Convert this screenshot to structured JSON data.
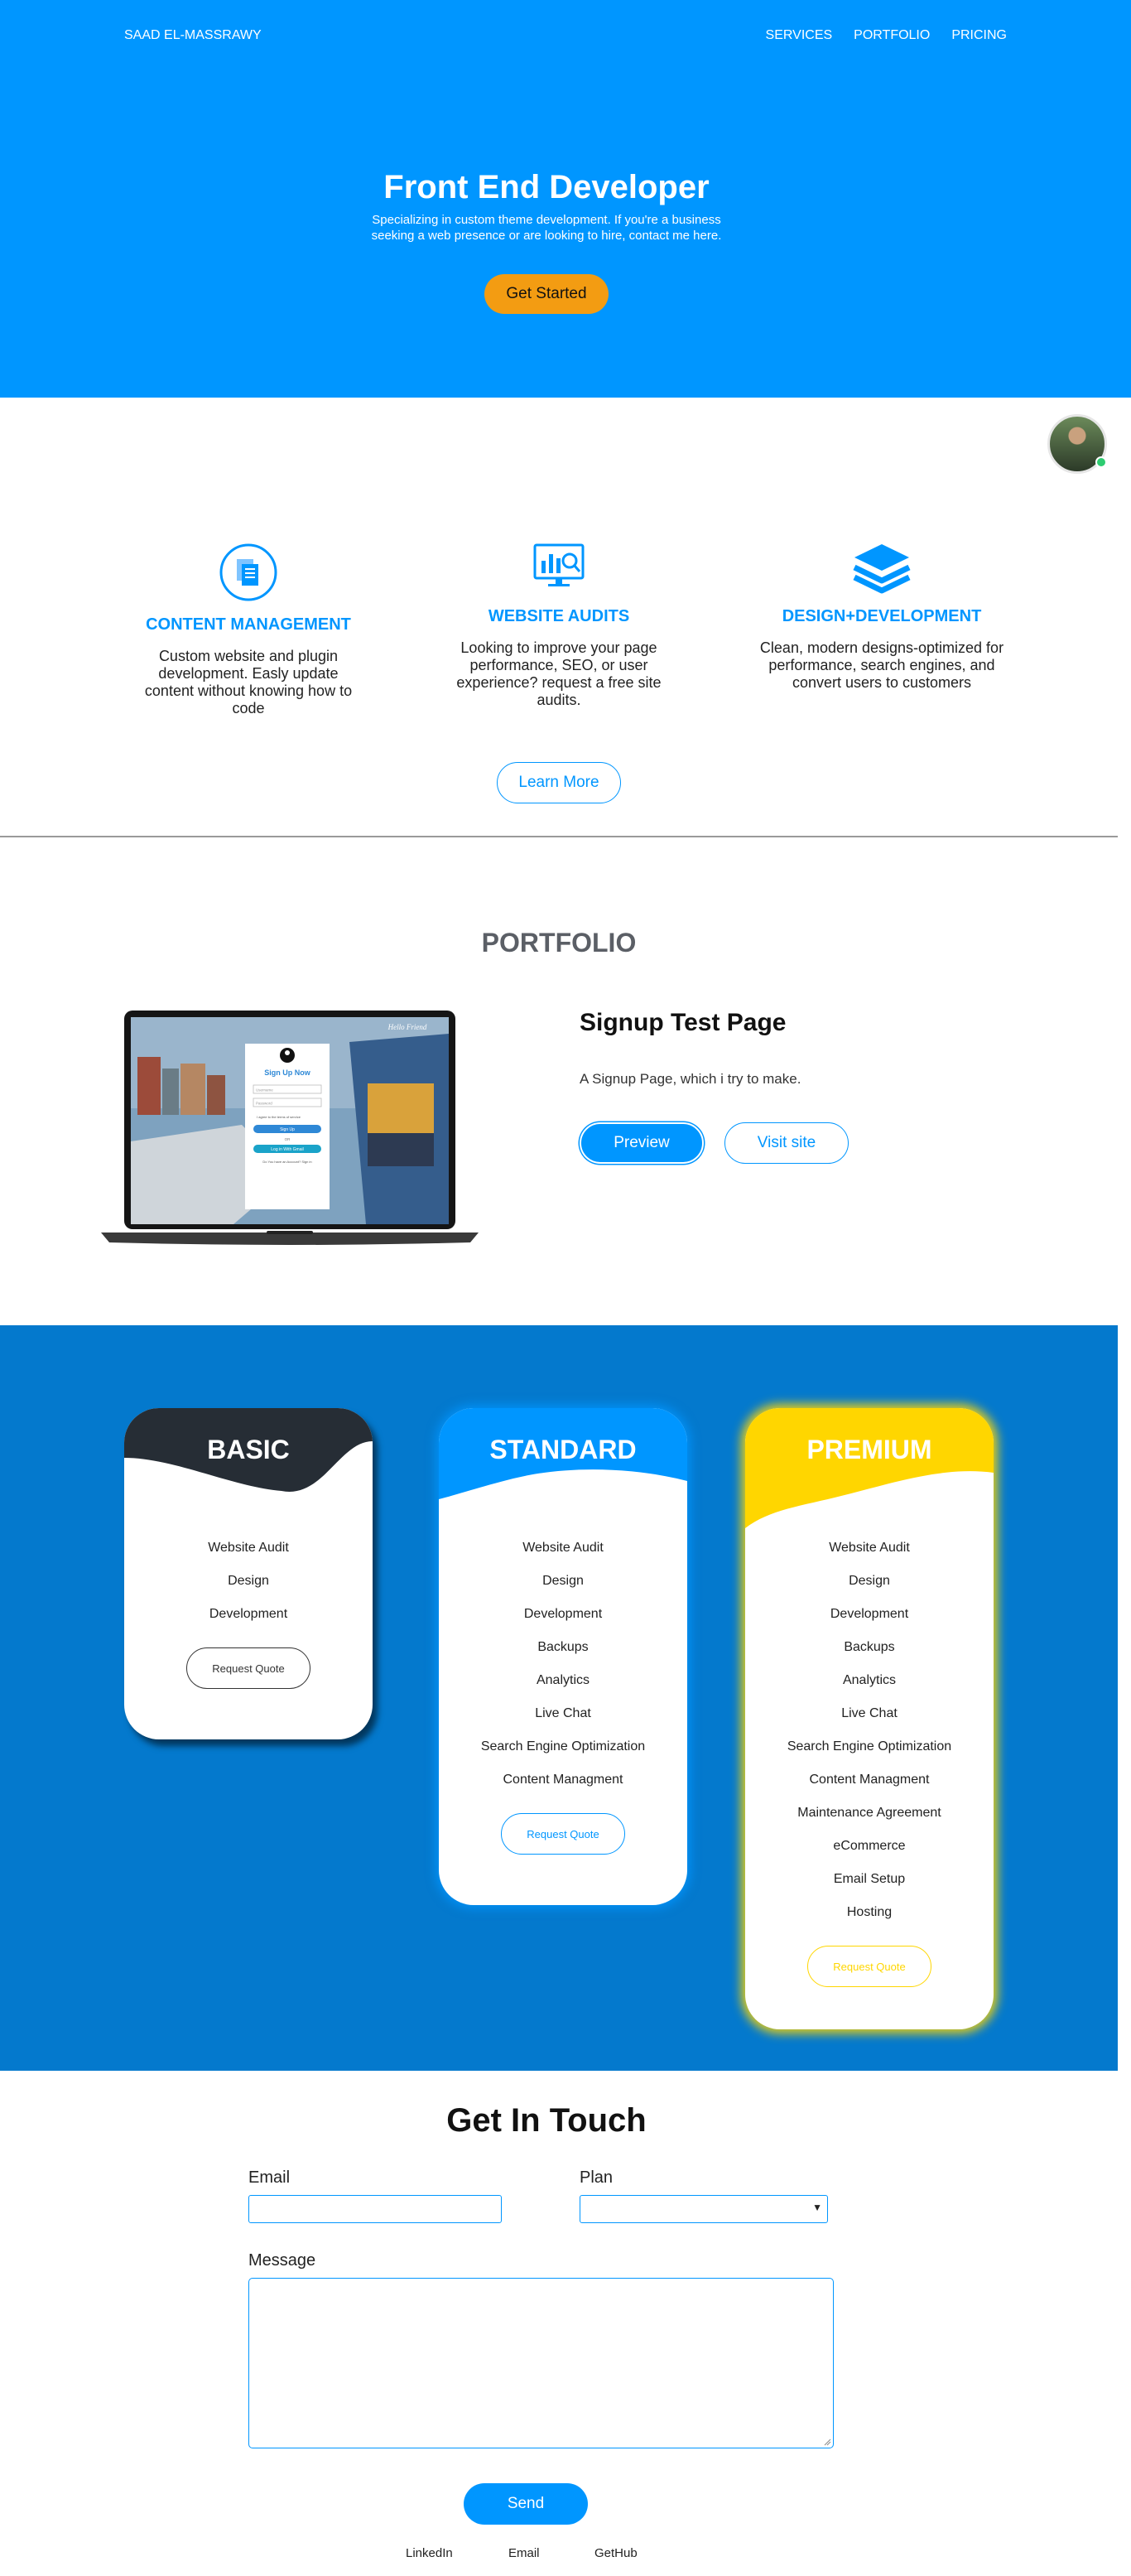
{
  "header": {
    "brand": "SAAD EL-MASSRAWY",
    "nav": [
      "SERVICES",
      "PORTFOLIO",
      "PRICING"
    ]
  },
  "hero": {
    "title": "Front End Developer",
    "subtitle": "Specializing in custom theme development. If you're a business seeking a web presence or are looking to hire, contact me here.",
    "cta": "Get Started"
  },
  "services": [
    {
      "icon": "documents-icon",
      "title": "CONTENT MANAGEMENT",
      "desc": "Custom website and plugin development. Easly update content without knowing how to code"
    },
    {
      "icon": "analytics-monitor-icon",
      "title": "WEBSITE AUDITS",
      "desc": "Looking to improve your page performance, SEO, or user experience? request a free site audits."
    },
    {
      "icon": "layers-icon",
      "title": "DESIGN+DEVELOPMENT",
      "desc": "Clean, modern designs-optimized for performance, search engines, and convert users to customers"
    }
  ],
  "learn_more": "Learn More",
  "portfolio": {
    "heading": "PORTFOLIO",
    "project_title": "Signup Test Page",
    "project_desc": "A Signup Page, which i try to make.",
    "preview": "Preview",
    "visit": "Visit site",
    "mock_screen": {
      "form_title": "Sign Up Now",
      "field1": "Username",
      "field2": "Password",
      "terms": "I agree to the terms of service",
      "signup": "Sign Up",
      "or": "OR",
      "alt_login": "Log in With Gmail",
      "footer": "Do You have an Account? Sign in",
      "side_caption": "Hello Friend"
    }
  },
  "pricing": {
    "plans": [
      {
        "name": "BASIC",
        "color": "#262d35",
        "features": [
          "Website Audit",
          "Design",
          "Development"
        ],
        "button": "Request Quote"
      },
      {
        "name": "STANDARD",
        "color": "#0096ff",
        "features": [
          "Website Audit",
          "Design",
          "Development",
          "Backups",
          "Analytics",
          "Live Chat",
          "Search Engine Optimization",
          "Content Managment"
        ],
        "button": "Request Quote"
      },
      {
        "name": "PREMIUM",
        "color": "#ffd600",
        "features": [
          "Website Audit",
          "Design",
          "Development",
          "Backups",
          "Analytics",
          "Live Chat",
          "Search Engine Optimization",
          "Content Managment",
          "Maintenance Agreement",
          "eCommerce",
          "Email Setup",
          "Hosting"
        ],
        "button": "Request Quote"
      }
    ]
  },
  "contact": {
    "title": "Get In Touch",
    "email_label": "Email",
    "email_value": "",
    "plan_label": "Plan",
    "plan_value": "",
    "message_label": "Message",
    "message_value": "",
    "send": "Send"
  },
  "footer": [
    "LinkedIn",
    "Email",
    "GetHub"
  ],
  "colors": {
    "primary": "#0096ff",
    "pricing_bg": "#0479cd",
    "cta": "#f39c12",
    "premium": "#ffd600",
    "basic": "#262d35"
  }
}
